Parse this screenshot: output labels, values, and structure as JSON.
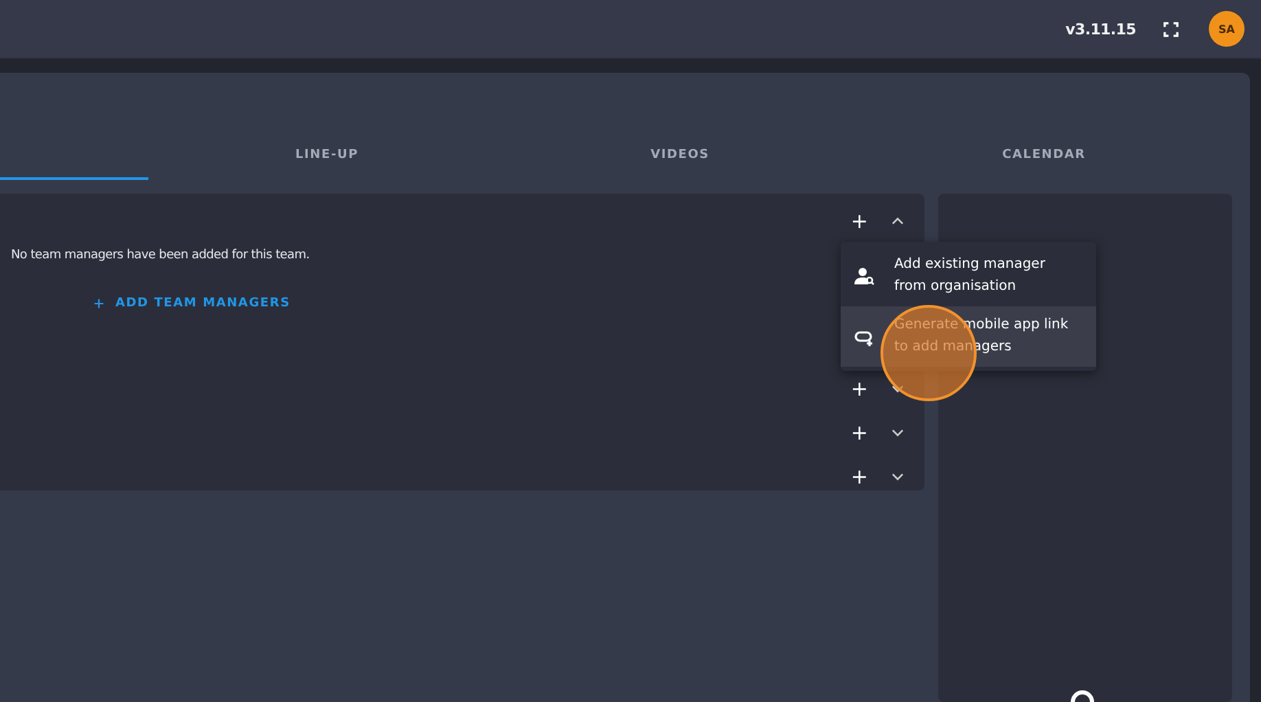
{
  "topbar": {
    "version": "v3.11.15",
    "avatar": "SA"
  },
  "tabs": [
    {
      "selected": true
    },
    {
      "label": "LINE-UP",
      "selected": false
    },
    {
      "label": "VIDEOS",
      "selected": false
    },
    {
      "label": "CALENDAR",
      "selected": false
    }
  ],
  "sections": [
    {
      "expanded": true,
      "message": "No team managers have been added for this team.",
      "action": "ADD TEAM MANAGERS",
      "add": "+"
    },
    {
      "expanded": false,
      "add": "+"
    },
    {
      "expanded": false,
      "add": "+"
    },
    {
      "expanded": false,
      "add": "+"
    }
  ],
  "menu": {
    "items": [
      {
        "kind": "person-search",
        "label": "Add existing manager from organisation",
        "selected": false
      },
      {
        "kind": "link",
        "label": "Generate mobile app link to add managers",
        "selected": true
      }
    ]
  },
  "click_indicator": true
}
